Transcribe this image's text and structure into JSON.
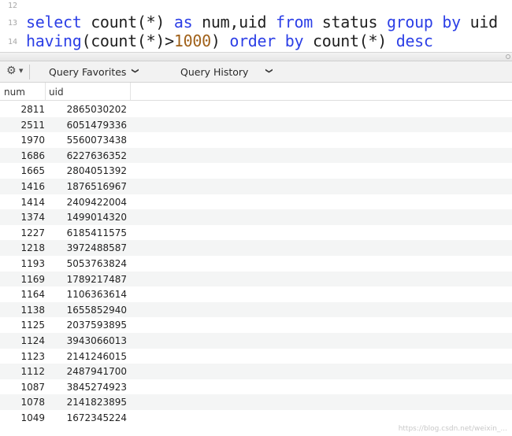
{
  "editor": {
    "lines": [
      {
        "num": "12"
      },
      {
        "num": "13",
        "p1": "select",
        "p2": " count(*) ",
        "p3": "as",
        "p4": " num,uid ",
        "p5": "from",
        "p6": " status ",
        "p7": "group",
        "p8": " ",
        "p9": "by",
        "p10": " uid"
      },
      {
        "num": "14",
        "p1": "having",
        "p2": "(count(*)>",
        "p3": "1000",
        "p4": ") ",
        "p5": "order",
        "p6": " ",
        "p7": "by",
        "p8": " count(*) ",
        "p9": "desc"
      }
    ]
  },
  "toolbar": {
    "gear_icon": "gear-icon",
    "favorites_label": "Query Favorites",
    "history_label": "Query History"
  },
  "results": {
    "columns": [
      "num",
      "uid"
    ],
    "rows": [
      [
        "2811",
        "2865030202"
      ],
      [
        "2511",
        "6051479336"
      ],
      [
        "1970",
        "5560073438"
      ],
      [
        "1686",
        "6227636352"
      ],
      [
        "1665",
        "2804051392"
      ],
      [
        "1416",
        "1876516967"
      ],
      [
        "1414",
        "2409422004"
      ],
      [
        "1374",
        "1499014320"
      ],
      [
        "1227",
        "6185411575"
      ],
      [
        "1218",
        "3972488587"
      ],
      [
        "1193",
        "5053763824"
      ],
      [
        "1169",
        "1789217487"
      ],
      [
        "1164",
        "1106363614"
      ],
      [
        "1138",
        "1655852940"
      ],
      [
        "1125",
        "2037593895"
      ],
      [
        "1124",
        "3943066013"
      ],
      [
        "1123",
        "2141246015"
      ],
      [
        "1112",
        "2487941700"
      ],
      [
        "1087",
        "3845274923"
      ],
      [
        "1078",
        "2141823895"
      ],
      [
        "1049",
        "1672345224"
      ]
    ]
  },
  "watermark": "https://blog.csdn.net/weixin_..."
}
